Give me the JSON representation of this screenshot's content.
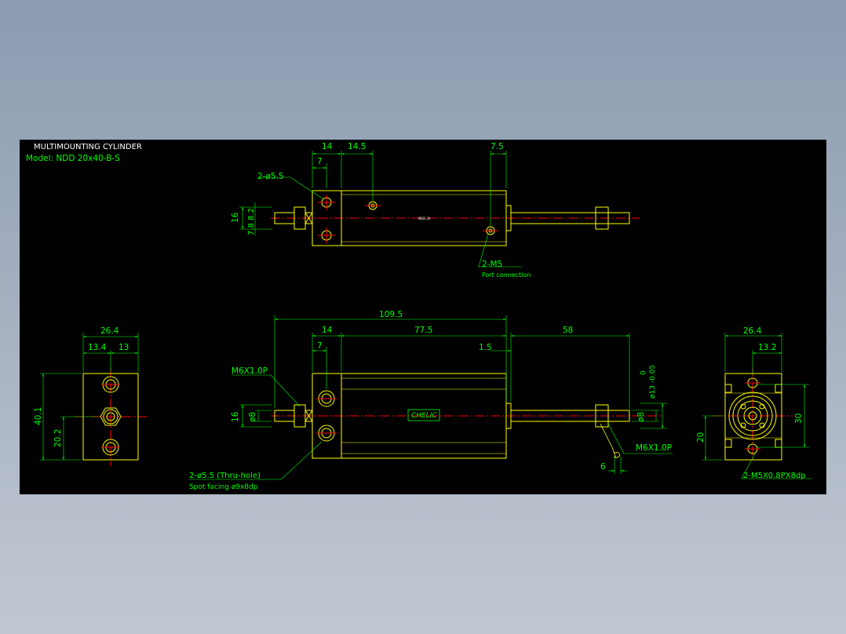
{
  "drawing": {
    "title": "MULTIMOUNTING CYLINDER",
    "model": "Model:  NDD 20x40-B-S"
  },
  "top_view": {
    "dims": {
      "d14": "14",
      "d145": "14.5",
      "d7": "7",
      "d75": "7.5",
      "d16": "16",
      "d7882": "7.8 8.2"
    },
    "callout_hole": "2-ø5.5",
    "callout_port": "2-M5",
    "port_note": "Port connection",
    "body_label": "NDD 20"
  },
  "front_view": {
    "dims": {
      "d1095": "109.5",
      "d14": "14",
      "d775": "77.5",
      "d58": "58",
      "d7": "7",
      "d15": "1.5",
      "d16": "16",
      "d8a": "ø8",
      "d8b": "ø8",
      "d13tol_a": "0",
      "d13tol_b": "ø13 -0.05",
      "d6": "6"
    },
    "callout_thread_left": "M6X1.0P",
    "callout_thread_right": "M6X1.0P",
    "callout_hole": "2-ø5.5 (Thru-hole)",
    "callout_facing": "Spot facing   ø9x8dp",
    "logo": "CHELIC"
  },
  "left_view": {
    "dims": {
      "d264": "26.4",
      "d134": "13.4",
      "d13": "13",
      "d401": "40.1",
      "d202": "20.2"
    }
  },
  "right_view": {
    "dims": {
      "d264": "26.4",
      "d132": "13.2",
      "d30": "30",
      "d20": "20"
    },
    "callout": "2-M5X0.8PX8dp"
  },
  "colors": {
    "background": "#000000",
    "outline": "#ffff00",
    "dimension": "#00ff00",
    "centerline": "#ff0000",
    "text": "#ffffff"
  }
}
